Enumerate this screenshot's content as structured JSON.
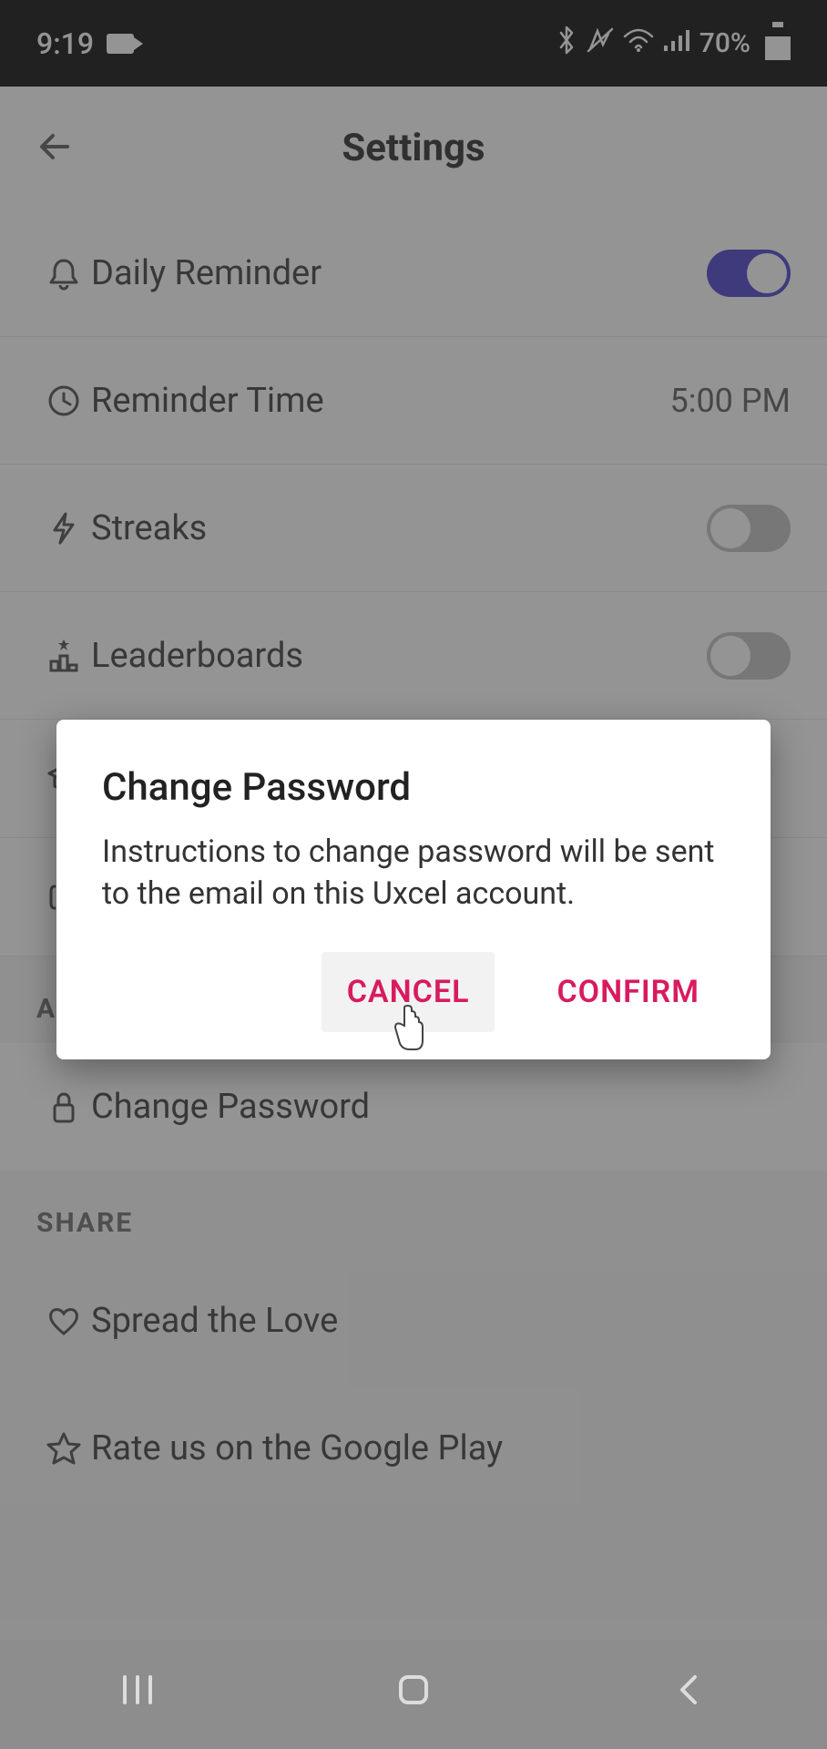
{
  "status": {
    "time": "9:19",
    "battery_text": "70%"
  },
  "header": {
    "title": "Settings"
  },
  "rows": {
    "daily_reminder": "Daily Reminder",
    "reminder_time": "Reminder Time",
    "reminder_time_value": "5:00 PM",
    "streaks": "Streaks",
    "leaderboards": "Leaderboards"
  },
  "sections": {
    "account": "ACCOUNT",
    "share": "SHARE"
  },
  "account": {
    "change_password": "Change Password"
  },
  "share": {
    "spread_love": "Spread the Love",
    "rate_us": "Rate us on the Google Play"
  },
  "dialog": {
    "title": "Change Password",
    "body": "Instructions to change password will be sent to the email on this Uxcel account.",
    "cancel": "CANCEL",
    "confirm": "CONFIRM"
  }
}
